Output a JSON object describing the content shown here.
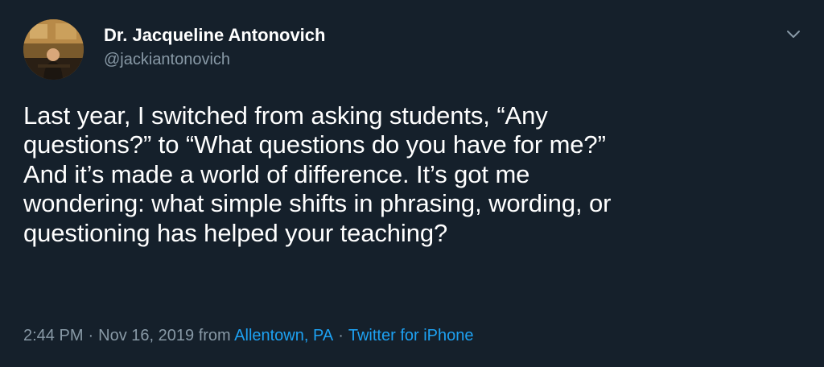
{
  "tweet": {
    "author": {
      "display_name": "Dr. Jacqueline Antonovich",
      "handle": "@jackiantonovich"
    },
    "text_lines": [
      "Last year, I switched from asking students, “Any",
      "questions?” to “What questions do you have for me?”",
      "And it’s made a world of difference. It’s got me",
      "wondering: what simple shifts in phrasing, wording, or",
      "questioning has helped your teaching?"
    ],
    "meta": {
      "time": "2:44 PM",
      "separator": "·",
      "date": "Nov 16, 2019",
      "from_label": "from",
      "location": "Allentown, PA",
      "source": "Twitter for iPhone"
    },
    "icons": {
      "menu": "chevron-down-icon",
      "avatar": "profile-photo"
    },
    "colors": {
      "background": "#15202b",
      "text": "#ffffff",
      "secondary": "#8899a6",
      "link": "#1da1f2"
    }
  }
}
